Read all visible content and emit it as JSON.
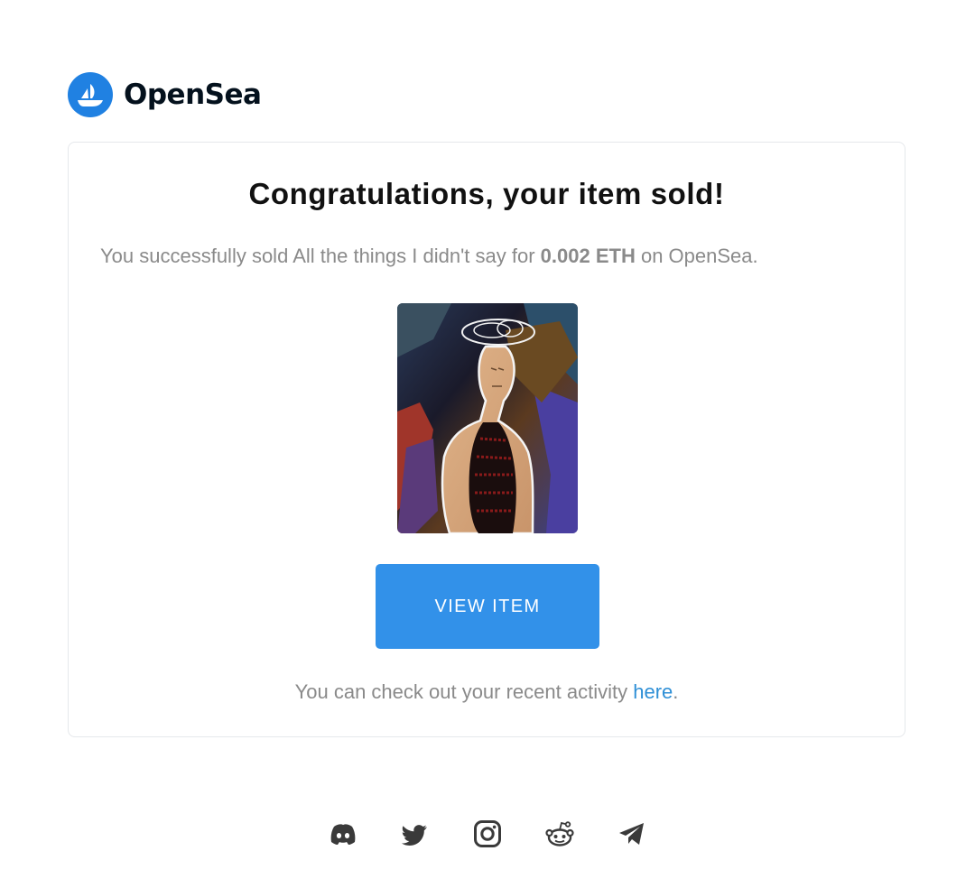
{
  "brand": {
    "name": "OpenSea",
    "logo_icon": "opensea-ship-icon",
    "color": "#2081e2"
  },
  "notification": {
    "headline": "Congratulations, your item sold!",
    "summary_prefix": "You successfully sold ",
    "item_name": "All the things I didn't say",
    "summary_for": " for ",
    "price": "0.002 ETH",
    "summary_suffix": " on OpenSea.",
    "image_alt": "All the things I didn't say",
    "view_button_label": "VIEW ITEM",
    "button_color": "#3291e9",
    "activity_prefix": "You can check out your recent activity ",
    "activity_link_label": "here",
    "activity_suffix": "."
  },
  "footer": {
    "social_icons": [
      "discord-icon",
      "twitter-icon",
      "instagram-icon",
      "reddit-icon",
      "telegram-icon"
    ]
  }
}
